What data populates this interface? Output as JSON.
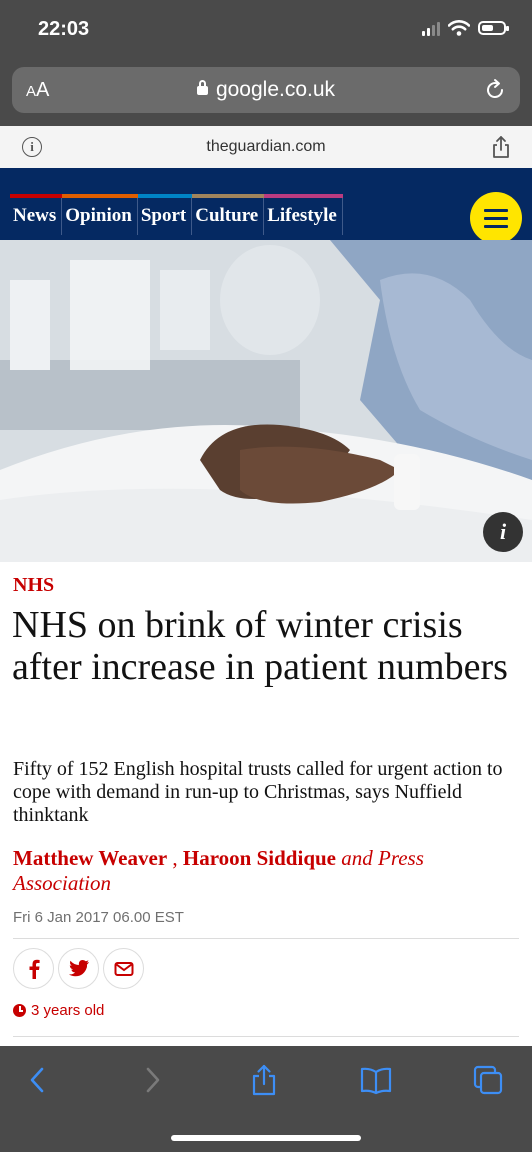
{
  "status_bar": {
    "time": "22:03",
    "battery_level": 0.55
  },
  "browser": {
    "aa_label": "AA",
    "url": "google.co.uk",
    "site_domain": "theguardian.com"
  },
  "guardian_nav": {
    "items": [
      {
        "label": "News",
        "color": "#c70000"
      },
      {
        "label": "Opinion",
        "color": "#e05e00"
      },
      {
        "label": "Sport",
        "color": "#0084c6"
      },
      {
        "label": "Culture",
        "color": "#a1845c"
      },
      {
        "label": "Lifestyle",
        "color": "#bb3b80"
      }
    ],
    "menu_icon": "hamburger-menu-icon",
    "accent": "#ffe500",
    "brand_blue": "#052962"
  },
  "hero": {
    "info_label": "i"
  },
  "article": {
    "kicker": "NHS",
    "headline": "NHS on brink of winter crisis after increase in patient numbers",
    "standfirst": "Fifty of 152 English hospital trusts called for urgent action to cope with demand in run-up to Christmas, says Nuffield thinktank",
    "byline": {
      "author1": "Matthew Weaver",
      "separator": " , ",
      "author2": "Haroon Siddique",
      "suffix": " and Press Association"
    },
    "date": "Fri 6 Jan 2017 06.00 EST",
    "share_icons": [
      "facebook-icon",
      "twitter-icon",
      "email-icon"
    ],
    "age_label": "3 years old"
  },
  "toolbar": {
    "icons": [
      "back-icon",
      "forward-icon",
      "share-icon",
      "bookmarks-icon",
      "tabs-icon"
    ]
  }
}
